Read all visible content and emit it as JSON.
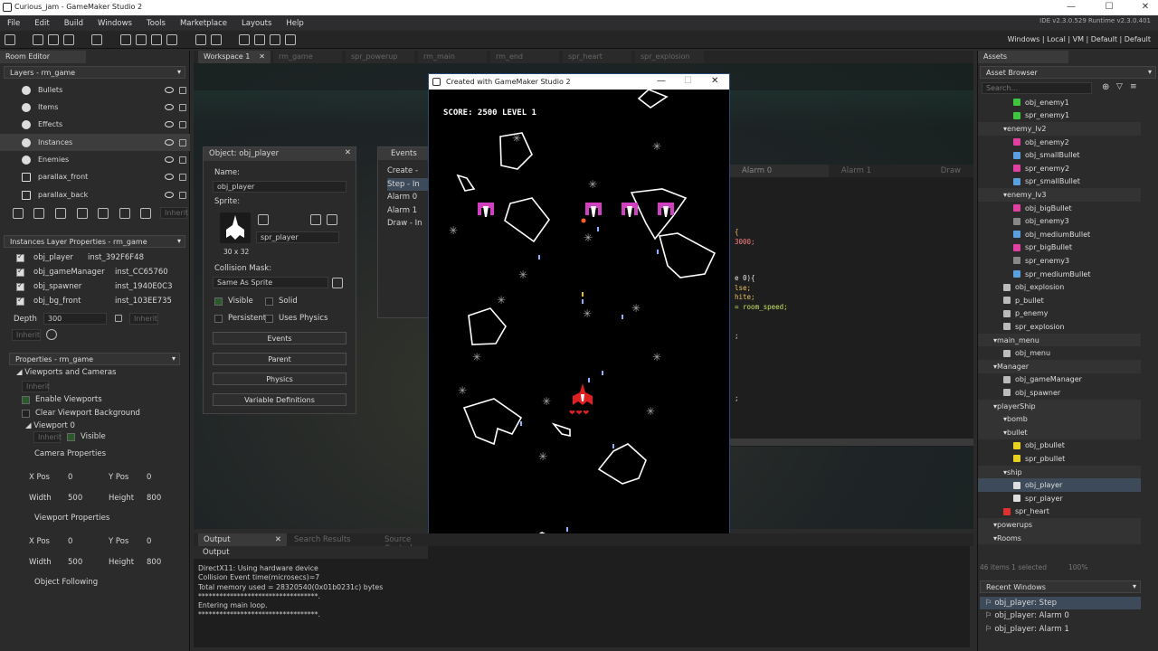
{
  "window": {
    "title": "Curious_jam - GameMaker Studio 2",
    "min": "—",
    "max": "☐",
    "close": "✕"
  },
  "menu": [
    "File",
    "Edit",
    "Build",
    "Windows",
    "Tools",
    "Marketplace",
    "Layouts",
    "Help"
  ],
  "toolbar": {
    "version": "IDE v2.3.0.529  Runtime v2.3.0.401",
    "target": "Windows | Local | VM | Default | Default"
  },
  "room_editor": {
    "tab": "Room Editor",
    "layers_header": "Layers - rm_game",
    "layers": [
      "Bullets",
      "Items",
      "Effects",
      "Instances",
      "Enemies",
      "parallax_front",
      "parallax_back"
    ],
    "inherit": "Inherit",
    "instances_header": "Instances Layer Properties - rm_game",
    "instances": [
      {
        "name": "obj_player",
        "id": "inst_392F6F48"
      },
      {
        "name": "obj_gameManager",
        "id": "inst_CC65760"
      },
      {
        "name": "obj_spawner",
        "id": "inst_1940E0C3"
      },
      {
        "name": "obj_bg_front",
        "id": "inst_103EE735"
      }
    ],
    "depth_label": "Depth",
    "depth_value": "300",
    "props_header": "Properties - rm_game",
    "viewports": "Viewports and Cameras",
    "enable_viewports": "Enable Viewports",
    "clear_bg": "Clear Viewport Background",
    "viewport0": "Viewport 0",
    "visible": "Visible",
    "camera_props": "Camera Properties",
    "viewport_props": "Viewport Properties",
    "object_following": "Object Following",
    "xpos": "X Pos",
    "ypos": "Y Pos",
    "width": "Width",
    "height": "Height",
    "cam": {
      "x": "0",
      "y": "0",
      "w": "500",
      "h": "800"
    },
    "vp": {
      "x": "0",
      "y": "0",
      "w": "500",
      "h": "800"
    }
  },
  "workspace": {
    "tabs": [
      "Workspace 1",
      "rm_game",
      "spr_powerup",
      "rm_main",
      "rm_end",
      "spr_heart",
      "spr_explosion"
    ]
  },
  "object_panel": {
    "title": "Object: obj_player",
    "name_label": "Name:",
    "name": "obj_player",
    "sprite_label": "Sprite:",
    "sprite": "spr_player",
    "sprite_size": "30 x 32",
    "mask_label": "Collision Mask:",
    "mask": "Same As Sprite",
    "visible": "Visible",
    "solid": "Solid",
    "persistent": "Persistent",
    "physics_chk": "Uses Physics",
    "events": "Events",
    "parent": "Parent",
    "physics": "Physics",
    "vars": "Variable Definitions"
  },
  "events_panel": {
    "title": "Events",
    "items": [
      "Create -",
      "Step - In",
      "Alarm 0",
      "Alarm 1",
      "Draw - In"
    ]
  },
  "code_tabs": [
    "Alarm 0",
    "Alarm 1",
    "Draw"
  ],
  "code_lines": [
    "{",
    "3000;",
    "",
    "",
    "e 0){",
    "lse;",
    "hite;",
    "  = room_speed;",
    "",
    "",
    "",
    ";",
    "",
    "",
    "",
    "",
    ";"
  ],
  "game": {
    "title": "Created with GameMaker Studio 2",
    "score": "SCORE: 2500 LEVEL 1",
    "hearts": "❤❤❤"
  },
  "output": {
    "tabs": [
      "Output",
      "Search Results",
      "Source Control"
    ],
    "title": "Output",
    "lines": [
      "DirectX11: Using hardware device",
      "Collision Event time(microsecs)=7",
      "Total memory used = 28320540(0x01b0231c) bytes",
      "**********************************.",
      "Entering main loop.",
      "**********************************."
    ]
  },
  "assets": {
    "tab": "Assets",
    "browser": "Asset Browser",
    "search": "Search...",
    "tree": [
      {
        "l": "obj_enemy1",
        "d": 3,
        "c": "#3ec63e"
      },
      {
        "l": "spr_enemy1",
        "d": 3,
        "c": "#3ec63e"
      },
      {
        "l": "enemy_lv2",
        "d": 2,
        "cat": 1
      },
      {
        "l": "obj_enemy2",
        "d": 3,
        "c": "#e040a0"
      },
      {
        "l": "obj_smallBullet",
        "d": 3,
        "c": "#5aa0e0"
      },
      {
        "l": "spr_enemy2",
        "d": 3,
        "c": "#e040a0"
      },
      {
        "l": "spr_smallBullet",
        "d": 3,
        "c": "#5aa0e0"
      },
      {
        "l": "enemy_lv3",
        "d": 2,
        "cat": 1
      },
      {
        "l": "obj_bigBullet",
        "d": 3,
        "c": "#e040a0"
      },
      {
        "l": "obj_enemy3",
        "d": 3,
        "c": "#888"
      },
      {
        "l": "obj_mediumBullet",
        "d": 3,
        "c": "#5aa0e0"
      },
      {
        "l": "spr_bigBullet",
        "d": 3,
        "c": "#e040a0"
      },
      {
        "l": "spr_enemy3",
        "d": 3,
        "c": "#888"
      },
      {
        "l": "spr_mediumBullet",
        "d": 3,
        "c": "#5aa0e0"
      },
      {
        "l": "obj_explosion",
        "d": 2,
        "c": "#bbb"
      },
      {
        "l": "p_bullet",
        "d": 2,
        "c": "#bbb"
      },
      {
        "l": "p_enemy",
        "d": 2,
        "c": "#bbb"
      },
      {
        "l": "spr_explosion",
        "d": 2,
        "c": "#bbb"
      },
      {
        "l": "main_menu",
        "d": 1,
        "cat": 1
      },
      {
        "l": "obj_menu",
        "d": 2,
        "c": "#bbb"
      },
      {
        "l": "Manager",
        "d": 1,
        "cat": 1
      },
      {
        "l": "obj_gameManager",
        "d": 2,
        "c": "#bbb"
      },
      {
        "l": "obj_spawner",
        "d": 2,
        "c": "#bbb"
      },
      {
        "l": "playerShip",
        "d": 1,
        "cat": 1
      },
      {
        "l": "bomb",
        "d": 2,
        "cat": 1
      },
      {
        "l": "bullet",
        "d": 2,
        "cat": 1
      },
      {
        "l": "obj_pbullet",
        "d": 3,
        "c": "#e8d020"
      },
      {
        "l": "spr_pbullet",
        "d": 3,
        "c": "#e8d020"
      },
      {
        "l": "ship",
        "d": 2,
        "cat": 1
      },
      {
        "l": "obj_player",
        "d": 3,
        "c": "#ddd",
        "sel": 1
      },
      {
        "l": "spr_player",
        "d": 3,
        "c": "#ddd"
      },
      {
        "l": "spr_heart",
        "d": 2,
        "c": "#e03030"
      },
      {
        "l": "powerups",
        "d": 1,
        "cat": 1
      },
      {
        "l": "Rooms",
        "d": 1,
        "cat": 1
      }
    ],
    "status": "46 items    1 selected",
    "zoom": "100%",
    "recent_header": "Recent Windows",
    "recent": [
      "obj_player: Step",
      "obj_player: Alarm 0",
      "obj_player: Alarm 1"
    ]
  }
}
